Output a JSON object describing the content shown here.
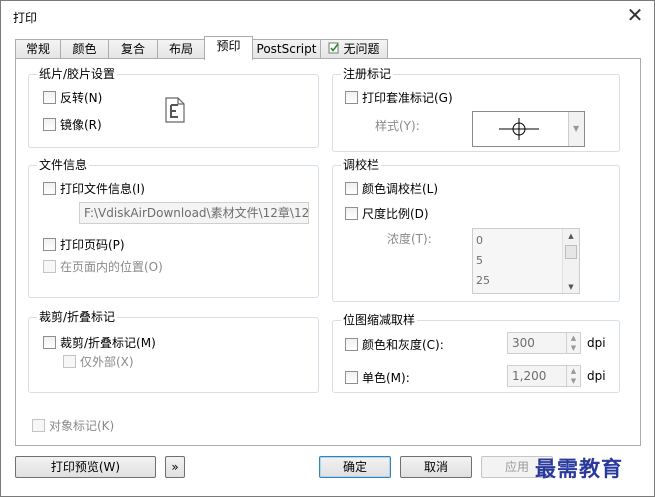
{
  "window": {
    "title": "打印"
  },
  "tabs": [
    {
      "label": "常规"
    },
    {
      "label": "颜色"
    },
    {
      "label": "复合"
    },
    {
      "label": "布局"
    },
    {
      "label": "预印"
    },
    {
      "label": "PostScript"
    },
    {
      "label": "无问题"
    }
  ],
  "paper": {
    "title": "纸片/胶片设置",
    "invert": "反转(N)",
    "mirror": "镜像(R)"
  },
  "registration": {
    "title": "注册标记",
    "print_marks": "打印套准标记(G)",
    "style_label": "样式(Y):"
  },
  "file_info": {
    "title": "文件信息",
    "print_file_info": "打印文件信息(I)",
    "path_value": "F:\\VdiskAirDownload\\素材文件\\12章\\12.2.",
    "print_page_numbers": "打印页码(P)",
    "position_in_page": "在页面内的位置(O)"
  },
  "calibration": {
    "title": "调校栏",
    "color_bar": "颜色调校栏(L)",
    "scale": "尺度比例(D)",
    "density_label": "浓度(T):",
    "density_items": [
      "0",
      "5",
      "25"
    ]
  },
  "crop": {
    "title": "裁剪/折叠标记",
    "crop_marks": "裁剪/折叠标记(M)",
    "exterior_only": "仅外部(X)"
  },
  "downsample": {
    "title": "位图缩减取样",
    "color_gray": "颜色和灰度(C):",
    "color_gray_value": "300",
    "mono": "单色(M):",
    "mono_value": "1,200",
    "unit": "dpi"
  },
  "object_marks": "对象标记(K)",
  "buttons": {
    "preview": "打印预览(W)",
    "expand": "»",
    "ok": "确定",
    "cancel": "取消",
    "apply": "应用"
  },
  "watermark": "最需教育"
}
